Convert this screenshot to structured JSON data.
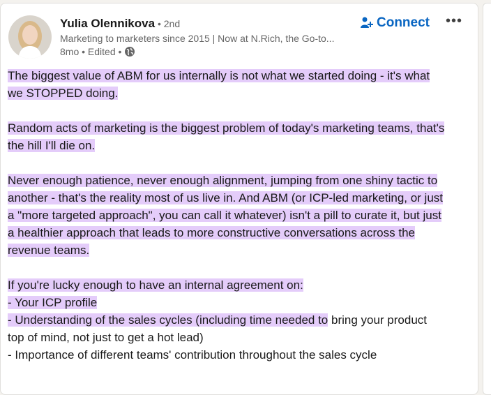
{
  "author": {
    "name": "Yulia Olennikova",
    "degree": " • 2nd",
    "headline": "Marketing to marketers since 2015 | Now at N.Rich, the Go-to...",
    "meta_time": "8mo • Edited •"
  },
  "actions": {
    "connect_label": "Connect",
    "more_label": "•••"
  },
  "post": {
    "p1_l1": "The biggest value of ABM for us internally is not what we started doing - it's what",
    "p1_l2": "we STOPPED doing.",
    "p2_l1": "Random acts of marketing is the biggest problem of today's marketing teams, that's",
    "p2_l2": "the hill I'll die on.",
    "p3_l1": "Never enough patience, never enough alignment, jumping from one shiny tactic to",
    "p3_l2": "another - that's the reality most of us live in. And ABM (or ICP-led marketing, or just",
    "p3_l3": "a \"more targeted approach\", you can call it whatever) isn't a pill to curate it, but just",
    "p3_l4": "a healthier approach that leads to more constructive conversations across the",
    "p3_l5": "revenue teams.",
    "p4_l1": "If you're lucky enough to have an internal agreement on:",
    "p4_l2": "- Your ICP profile",
    "p4_l3a": "- Understanding of the sales cycles (including time needed to",
    "p4_l3b": " bring your product",
    "p4_l4": "top of mind, not just to get a hot lead)",
    "p4_l5": "- Importance of different teams' contribution throughout the sales cycle"
  },
  "colors": {
    "highlight": "#e4ccfa",
    "link_blue": "#0a66c2"
  }
}
